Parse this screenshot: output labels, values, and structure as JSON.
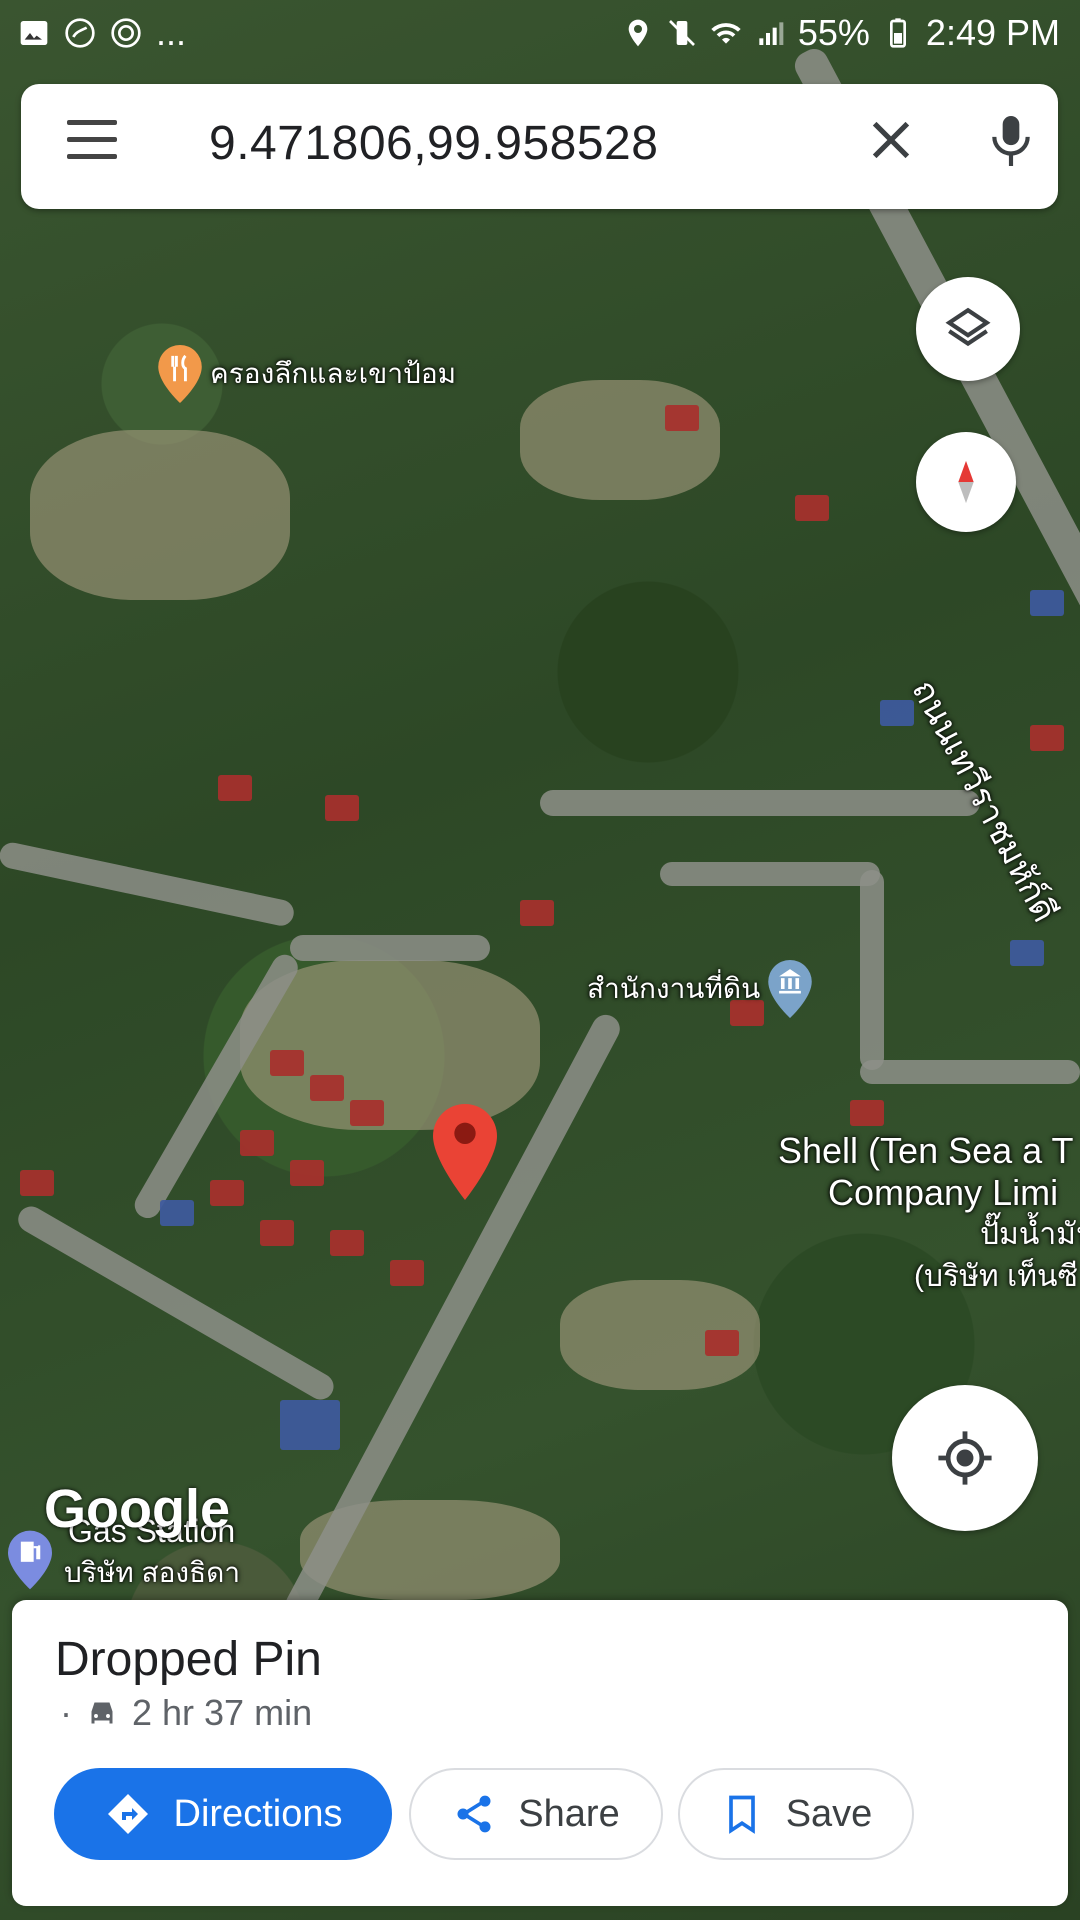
{
  "status_bar": {
    "left_icons": [
      "image-icon",
      "missed-call-icon",
      "sync-icon"
    ],
    "overflow": "...",
    "battery": "55%",
    "time": "2:49 PM"
  },
  "search": {
    "query": "9.471806,99.958528",
    "menu_icon": "hamburger-menu-icon",
    "clear_icon": "close-icon",
    "mic_icon": "microphone-icon"
  },
  "map": {
    "poi_restaurant": "ครองลึกและเขาป้อม",
    "poi_office": "สำนักงานที่ดิน",
    "road_label": "ถนนเทวีราชมหัก์ดี",
    "shell_line1": "Shell (Ten Sea a T",
    "shell_line2": "Company Limi",
    "shell_line3": "ปั๊มน้ำมัน",
    "shell_line4": "(บริษัท เท็นซี",
    "gas_title": "Gas Station",
    "gas_line2": "บริษัท สองธิดา",
    "logo": "Google",
    "accent_pin": "#ea4335"
  },
  "place_sheet": {
    "title": "Dropped Pin",
    "bullet": "·",
    "eta": "2 hr 37 min",
    "directions_label": "Directions",
    "share_label": "Share",
    "save_label": "Save",
    "accent": "#1a73e8"
  }
}
